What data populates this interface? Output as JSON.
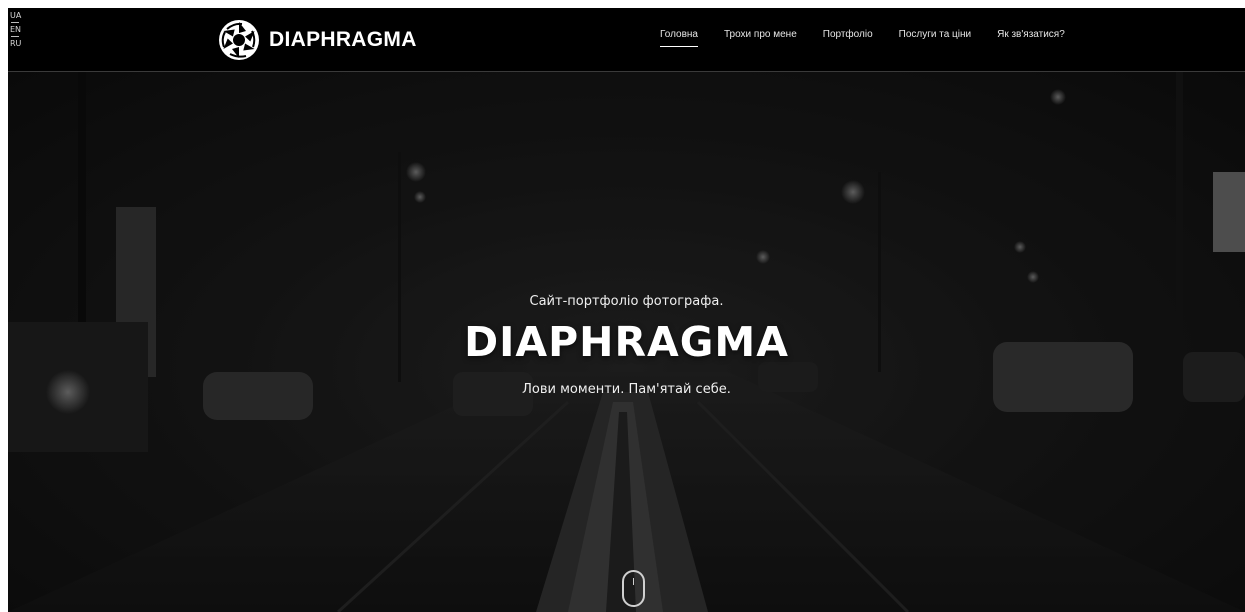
{
  "languages": [
    "UA",
    "EN",
    "RU"
  ],
  "brand": {
    "name": "DIAPHRAGMA",
    "icon": "aperture-icon"
  },
  "nav": {
    "items": [
      {
        "label": "Головна",
        "active": true
      },
      {
        "label": "Трохи про мене",
        "active": false
      },
      {
        "label": "Портфоліо",
        "active": false
      },
      {
        "label": "Послуги та ціни",
        "active": false
      },
      {
        "label": "Як зв'язатися?",
        "active": false
      }
    ]
  },
  "hero": {
    "subtitle": "Сайт-портфоліо фотографа.",
    "title": "DIAPHRAGMA",
    "tagline": "Лови моменти. Пам'ятай себе.",
    "scroll_icon": "scroll-mouse-icon"
  },
  "colors": {
    "header_bg": "#000000",
    "text": "#ffffff",
    "hero_bg": "#1d1d1d"
  }
}
